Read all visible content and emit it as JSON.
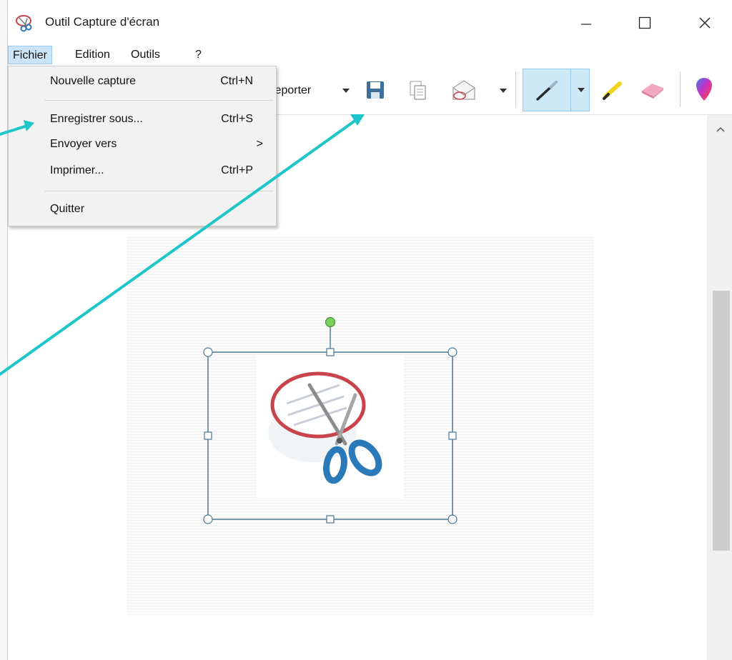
{
  "window": {
    "title": "Outil Capture d'écran",
    "controls": {
      "minimize": "–",
      "maximize": "☐",
      "close": "✕"
    }
  },
  "menubar": {
    "items": [
      {
        "label": "Fichier",
        "active": true
      },
      {
        "label": "Edition",
        "active": false
      },
      {
        "label": "Outils",
        "active": false
      },
      {
        "label": "?",
        "active": false
      }
    ]
  },
  "toolbar": {
    "delay_label": "Reporter",
    "icons": [
      "save-icon",
      "copy-icon",
      "send-icon",
      "pen-icon",
      "highlighter-icon",
      "eraser-icon",
      "paint3d-icon"
    ]
  },
  "file_menu": {
    "items": [
      {
        "label": "Nouvelle capture",
        "shortcut": "Ctrl+N"
      },
      {
        "label": "Enregistrer sous...",
        "shortcut": "Ctrl+S"
      },
      {
        "label": "Envoyer vers",
        "shortcut": "",
        "submenu": ">"
      },
      {
        "label": "Imprimer...",
        "shortcut": "Ctrl+P"
      },
      {
        "label": "Quitter",
        "shortcut": ""
      }
    ]
  },
  "colors": {
    "arrow": "#1ec6c9",
    "menu_active_bg": "#cce4f7",
    "toolbar_active_bg": "#cde8f7",
    "selection_frame": "#4a7893"
  }
}
